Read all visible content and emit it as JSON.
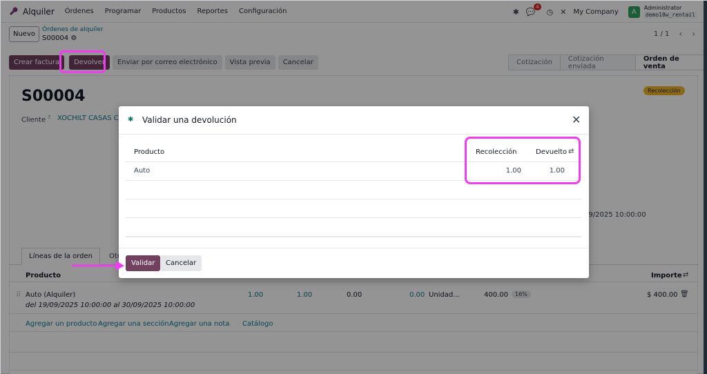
{
  "navbar": {
    "app_name": "Alquiler",
    "menu": [
      "Órdenes",
      "Programar",
      "Productos",
      "Reportes",
      "Configuración"
    ],
    "message_count": "4",
    "company": "My Company",
    "avatar_letter": "A",
    "user_name": "Administrator",
    "db_name": "demo18w_rentail"
  },
  "control": {
    "new_label": "Nuevo",
    "breadcrumb": "Órdenes de alquiler",
    "record_id": "S00004",
    "pager": "1 / 1"
  },
  "actions": {
    "create_invoice": "Crear factura",
    "return": "Devolver",
    "send_email": "Enviar por correo electrónico",
    "preview": "Vista previa",
    "cancel": "Cancelar"
  },
  "status": {
    "stages": [
      "Cotización",
      "Cotización enviada",
      "Orden de venta"
    ],
    "active_index": 2
  },
  "form": {
    "title": "S00004",
    "rental_status": "Recolección",
    "customer_label": "Cliente",
    "customer_help": "?",
    "customer_value": "XOCHILT CASAS CI",
    "date_value": "/9/2025 10:00:00"
  },
  "tabs": {
    "lines": "Líneas de la orden",
    "other": "Otra i"
  },
  "lines": {
    "col_product": "Producto",
    "col_amount": "Importe",
    "row": {
      "product": "Auto (Alquiler)",
      "dates": "del 19/09/2025 10:00:00 al 30/09/2025 10:00:00",
      "qty": "1.00",
      "delivered": "1.00",
      "returned": "0.00",
      "invoiced": "0.00",
      "uom": "Unidad...",
      "unit_price": "400.00",
      "tax": "16%",
      "amount": "$ 400.00"
    },
    "add_product": "Agregar un producto",
    "add_section": "Agregar una sección",
    "add_note": "Agregar una nota",
    "catalog": "Catálogo"
  },
  "modal": {
    "title": "Validar una devolución",
    "col_product": "Producto",
    "col_pickup": "Recolección",
    "col_returned": "Devuelto",
    "row": {
      "product": "Auto",
      "pickup": "1.00",
      "returned": "1.00"
    },
    "validate": "Validar",
    "cancel": "Cancelar"
  },
  "colors": {
    "primary": "#71415f",
    "link": "#0e7490",
    "highlight": "#ee3eef",
    "pickup_tag": "#f0b429"
  }
}
